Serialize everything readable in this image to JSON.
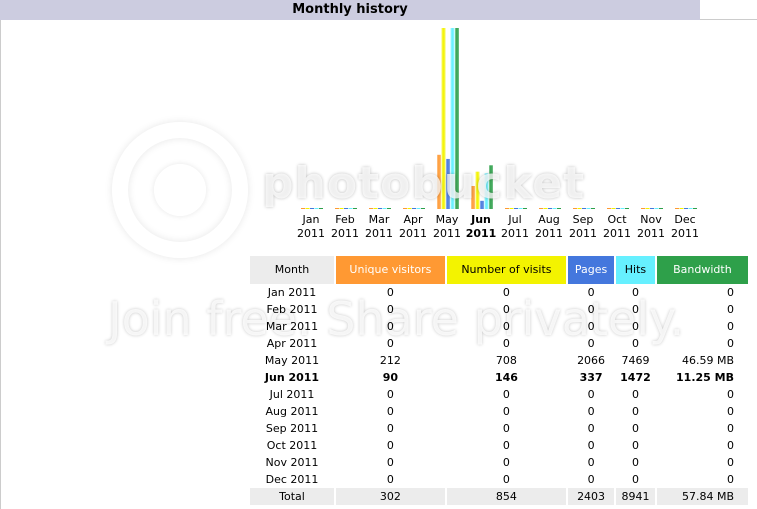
{
  "title": "Monthly history",
  "watermark": {
    "brand": "photobucket",
    "tagline": "Join free. Share privately."
  },
  "colors": {
    "unique": "#ff9933",
    "visits": "#f3f300",
    "pages": "#4477dd",
    "hits": "#66f0ff",
    "bandwidth": "#2ea04a",
    "title_bar": "#cccce0"
  },
  "headers": {
    "month": "Month",
    "unique": "Unique visitors",
    "visits": "Number of visits",
    "pages": "Pages",
    "hits": "Hits",
    "bandwidth": "Bandwidth"
  },
  "rows": [
    {
      "month": "Jan 2011",
      "unique": "0",
      "visits": "0",
      "pages": "0",
      "hits": "0",
      "bandwidth": "0"
    },
    {
      "month": "Feb 2011",
      "unique": "0",
      "visits": "0",
      "pages": "0",
      "hits": "0",
      "bandwidth": "0"
    },
    {
      "month": "Mar 2011",
      "unique": "0",
      "visits": "0",
      "pages": "0",
      "hits": "0",
      "bandwidth": "0"
    },
    {
      "month": "Apr 2011",
      "unique": "0",
      "visits": "0",
      "pages": "0",
      "hits": "0",
      "bandwidth": "0"
    },
    {
      "month": "May 2011",
      "unique": "212",
      "visits": "708",
      "pages": "2066",
      "hits": "7469",
      "bandwidth": "46.59 MB"
    },
    {
      "month": "Jun 2011",
      "unique": "90",
      "visits": "146",
      "pages": "337",
      "hits": "1472",
      "bandwidth": "11.25 MB",
      "current": true
    },
    {
      "month": "Jul 2011",
      "unique": "0",
      "visits": "0",
      "pages": "0",
      "hits": "0",
      "bandwidth": "0"
    },
    {
      "month": "Aug 2011",
      "unique": "0",
      "visits": "0",
      "pages": "0",
      "hits": "0",
      "bandwidth": "0"
    },
    {
      "month": "Sep 2011",
      "unique": "0",
      "visits": "0",
      "pages": "0",
      "hits": "0",
      "bandwidth": "0"
    },
    {
      "month": "Oct 2011",
      "unique": "0",
      "visits": "0",
      "pages": "0",
      "hits": "0",
      "bandwidth": "0"
    },
    {
      "month": "Nov 2011",
      "unique": "0",
      "visits": "0",
      "pages": "0",
      "hits": "0",
      "bandwidth": "0"
    },
    {
      "month": "Dec 2011",
      "unique": "0",
      "visits": "0",
      "pages": "0",
      "hits": "0",
      "bandwidth": "0"
    }
  ],
  "total": {
    "month": "Total",
    "unique": "302",
    "visits": "854",
    "pages": "2403",
    "hits": "8941",
    "bandwidth": "57.84 MB"
  },
  "chart_data": {
    "type": "bar",
    "categories": [
      [
        "Jan",
        "2011"
      ],
      [
        "Feb",
        "2011"
      ],
      [
        "Mar",
        "2011"
      ],
      [
        "Apr",
        "2011"
      ],
      [
        "May",
        "2011"
      ],
      [
        "Jun",
        "2011"
      ],
      [
        "Jul",
        "2011"
      ],
      [
        "Aug",
        "2011"
      ],
      [
        "Sep",
        "2011"
      ],
      [
        "Oct",
        "2011"
      ],
      [
        "Nov",
        "2011"
      ],
      [
        "Dec",
        "2011"
      ]
    ],
    "current_index": 5,
    "series": [
      {
        "key": "unique",
        "color": "#ff9933",
        "group": "visitors",
        "values": [
          0,
          0,
          0,
          0,
          212,
          90,
          0,
          0,
          0,
          0,
          0,
          0
        ]
      },
      {
        "key": "visits",
        "color": "#f3f300",
        "group": "visitors",
        "values": [
          0,
          0,
          0,
          0,
          708,
          146,
          0,
          0,
          0,
          0,
          0,
          0
        ]
      },
      {
        "key": "pages",
        "color": "#4477dd",
        "group": "hits",
        "values": [
          0,
          0,
          0,
          0,
          2066,
          337,
          0,
          0,
          0,
          0,
          0,
          0
        ]
      },
      {
        "key": "hits",
        "color": "#66f0ff",
        "group": "hits",
        "values": [
          0,
          0,
          0,
          0,
          7469,
          1472,
          0,
          0,
          0,
          0,
          0,
          0
        ]
      },
      {
        "key": "bandwidth",
        "color": "#2ea04a",
        "group": "bandwidth",
        "unit": "MB",
        "values": [
          0,
          0,
          0,
          0,
          46.59,
          11.25,
          0,
          0,
          0,
          0,
          0,
          0
        ]
      }
    ],
    "legend": "none",
    "grid": false
  }
}
